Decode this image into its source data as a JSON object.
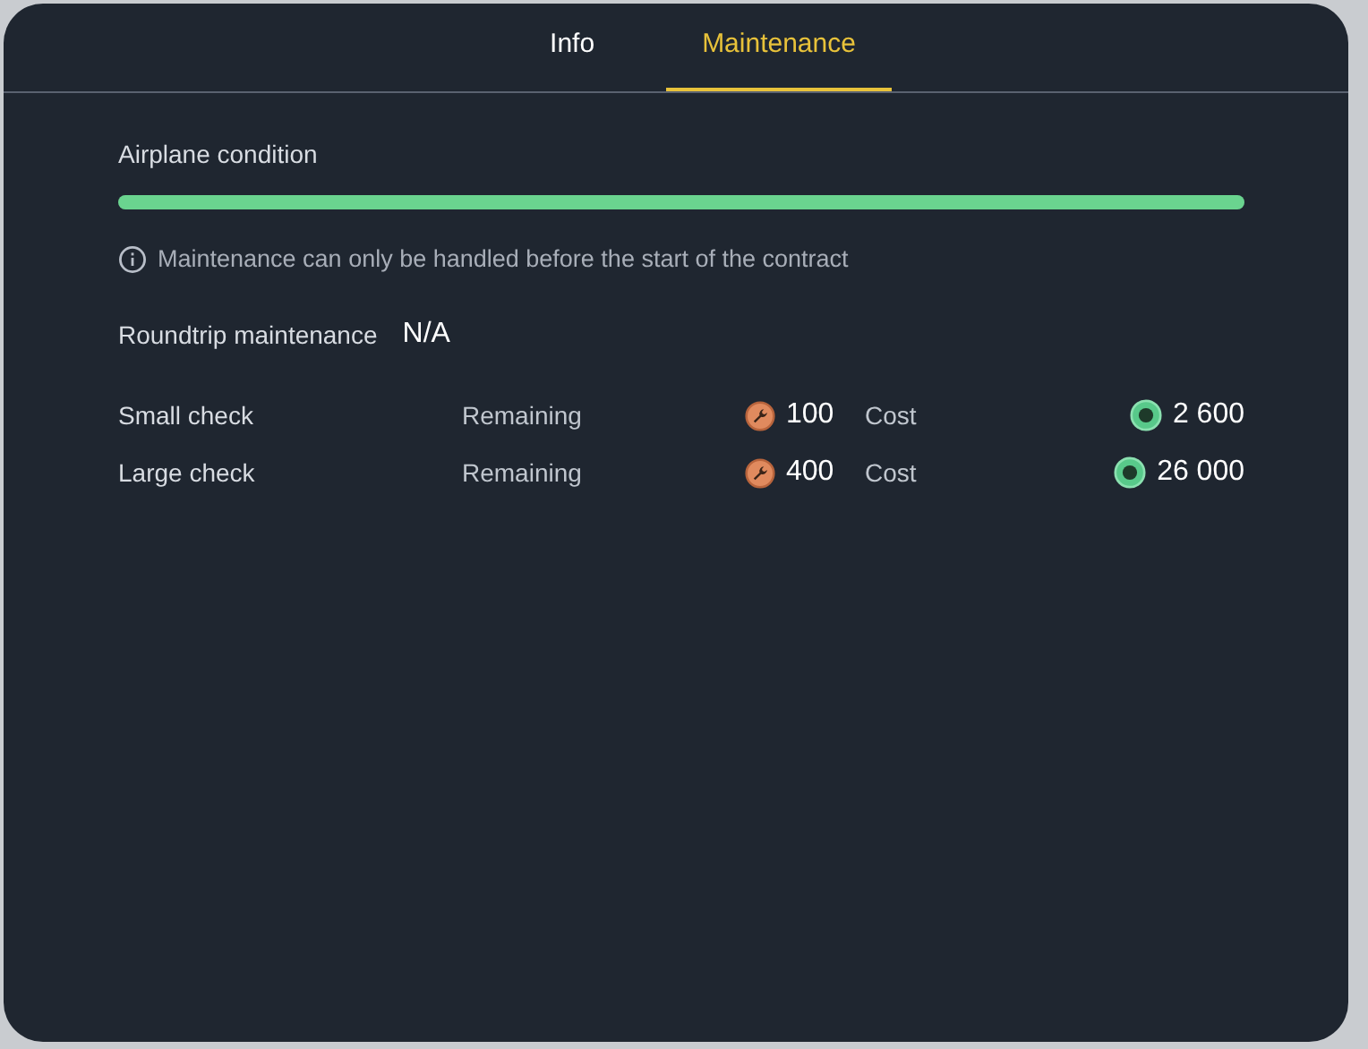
{
  "tabs": [
    {
      "label": "Info",
      "selected": false
    },
    {
      "label": "Maintenance",
      "selected": true
    }
  ],
  "condition": {
    "label": "Airplane condition",
    "level": 1.0
  },
  "notice": "Maintenance can only be handled before the start of the contract",
  "roundtrip": {
    "label": "Roundtrip maintenance",
    "value": "N/A"
  },
  "checks": [
    {
      "name": "Small check",
      "remaining_label": "Remaining",
      "remaining": "100",
      "cost_label": "Cost",
      "cost": "2 600"
    },
    {
      "name": "Large check",
      "remaining_label": "Remaining",
      "remaining": "400",
      "cost_label": "Cost",
      "cost": "26 000"
    }
  ]
}
